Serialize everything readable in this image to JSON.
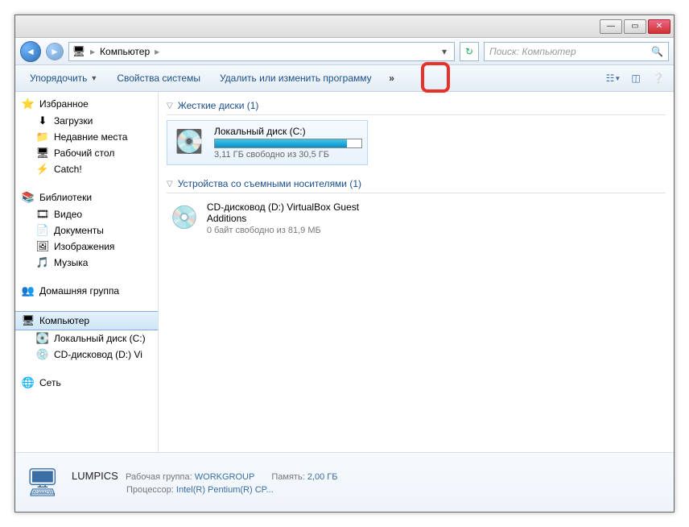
{
  "titlebar": {
    "min": "—",
    "max": "▭",
    "close": "✕"
  },
  "nav": {
    "location_icon": "🖥",
    "location": "Компьютер",
    "sep": "▸",
    "search_placeholder": "Поиск: Компьютер"
  },
  "toolbar": {
    "organize": "Упорядочить",
    "system_props": "Свойства системы",
    "uninstall": "Удалить или изменить программу",
    "overflow": "»"
  },
  "sidebar": {
    "favorites": {
      "label": "Избранное",
      "items": [
        {
          "icon": "⬇",
          "label": "Загрузки"
        },
        {
          "icon": "📁",
          "label": "Недавние места"
        },
        {
          "icon": "🖥",
          "label": "Рабочий стол"
        },
        {
          "icon": "⚡",
          "label": "Catch!"
        }
      ]
    },
    "libraries": {
      "label": "Библиотеки",
      "items": [
        {
          "icon": "🎞",
          "label": "Видео"
        },
        {
          "icon": "📄",
          "label": "Документы"
        },
        {
          "icon": "🖼",
          "label": "Изображения"
        },
        {
          "icon": "🎵",
          "label": "Музыка"
        }
      ]
    },
    "homegroup": {
      "icon": "👥",
      "label": "Домашняя группа"
    },
    "computer": {
      "icon": "🖥",
      "label": "Компьютер",
      "items": [
        {
          "icon": "💽",
          "label": "Локальный диск (C:)"
        },
        {
          "icon": "💿",
          "label": "CD-дисковод (D:) Vi"
        }
      ]
    },
    "network": {
      "icon": "🌐",
      "label": "Сеть"
    }
  },
  "content": {
    "hdd_header": "Жесткие диски (1)",
    "drive_c": {
      "label": "Локальный диск (C:)",
      "fill_pct": 90,
      "subtext": "3,11 ГБ свободно из 30,5 ГБ"
    },
    "removable_header": "Устройства со съемными носителями (1)",
    "cd": {
      "name": "CD-дисковод (D:) VirtualBox Guest Additions",
      "subtext": "0 байт свободно из 81,9 МБ"
    }
  },
  "details": {
    "pcname": "LUMPICS",
    "workgroup_lbl": "Рабочая группа:",
    "workgroup_val": "WORKGROUP",
    "mem_lbl": "Память:",
    "mem_val": "2,00 ГБ",
    "cpu_lbl": "Процессор:",
    "cpu_val": "Intel(R) Pentium(R) CP..."
  }
}
